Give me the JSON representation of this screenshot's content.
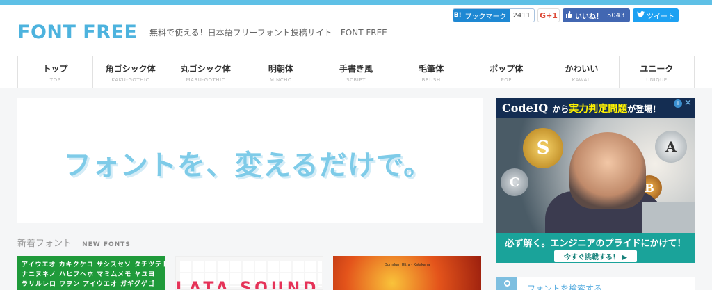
{
  "site": {
    "logo": "FONT FREE",
    "tagline": "無料で使える！日本語フリーフォント投稿サイト - FONT FREE"
  },
  "social": {
    "hatena_icon": "B!",
    "hatena_label": "ブックマーク",
    "hatena_count": "2411",
    "gplus_label": "G+1",
    "like_label": "いいね！",
    "like_count": "5043",
    "tweet_label": "ツイート"
  },
  "nav": [
    {
      "jp": "トップ",
      "en": "TOP"
    },
    {
      "jp": "角ゴシック体",
      "en": "KAKU-GOTHIC"
    },
    {
      "jp": "丸ゴシック体",
      "en": "MARU-GOTHIC"
    },
    {
      "jp": "明朝体",
      "en": "MINCHO"
    },
    {
      "jp": "手書き風",
      "en": "SCRIPT"
    },
    {
      "jp": "毛筆体",
      "en": "BRUSH"
    },
    {
      "jp": "ポップ体",
      "en": "POP"
    },
    {
      "jp": "かわいい",
      "en": "KAWAII"
    },
    {
      "jp": "ユニーク",
      "en": "UNIQUE"
    }
  ],
  "hero": {
    "text": "フォントを、変えるだけで。"
  },
  "new_fonts": {
    "title_jp": "新着フォント",
    "title_en": "NEW FONTS",
    "thumb1_lines": [
      "アイウエオ カキクケコ サシスセソ タチツテト",
      "ナニヌネノ ハヒフヘホ マミムメモ ヤユヨ",
      "ラリルレロ ワヲン アイウエオ ガギグゲゴ"
    ],
    "thumb2_word": "LATA SOUND",
    "thumb3_caption": "Dumdum Ultra - Katakana"
  },
  "ad": {
    "brand": "CodeIQ",
    "headline_pre": "から",
    "headline_bold": "実力判定問題",
    "headline_post": "が登場！",
    "info_icon": "i",
    "close_icon": "✕",
    "coin_s": "S",
    "coin_c": "C",
    "coin_a": "A",
    "coin_b": "B",
    "slogan": "必ず解く。エンジニアのプライドにかけて！",
    "cta": "今すぐ挑戦する！ ▶"
  },
  "search": {
    "label": "フォントを検索する"
  },
  "colors": {
    "accent": "#4db3de",
    "topbar": "#5ec0e6",
    "hero_text": "#7ecbe8",
    "ad_teal": "#1aa39a"
  }
}
